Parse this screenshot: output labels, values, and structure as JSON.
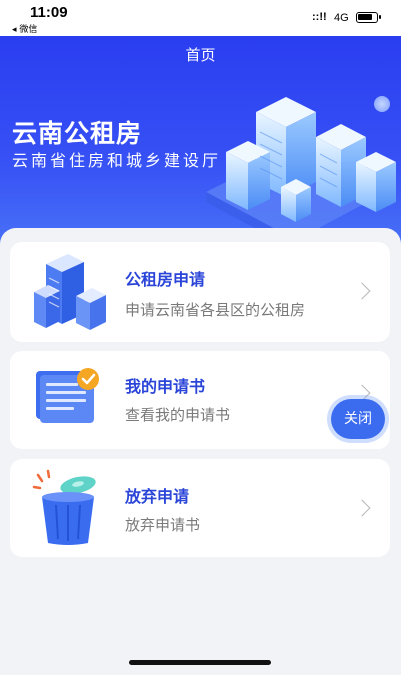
{
  "status_bar": {
    "time": "11:09",
    "back_label": "◂ 微信",
    "signal": "::!!",
    "network": "4G"
  },
  "nav": {
    "title": "首页"
  },
  "banner": {
    "title": "云南公租房",
    "subtitle": "云南省住房和城乡建设厅"
  },
  "cards": [
    {
      "title": "公租房申请",
      "desc": "申请云南省各县区的公租房",
      "icon": "buildings-icon"
    },
    {
      "title": "我的申请书",
      "desc": "查看我的申请书",
      "icon": "document-check-icon"
    },
    {
      "title": "放弃申请",
      "desc": "放弃申请书",
      "icon": "trash-can-icon"
    }
  ],
  "close_button": {
    "label": "关闭"
  },
  "colors": {
    "brand_blue": "#2a45d8",
    "banner_blue": "#3650f5",
    "fab_blue": "#3b6cf0"
  }
}
